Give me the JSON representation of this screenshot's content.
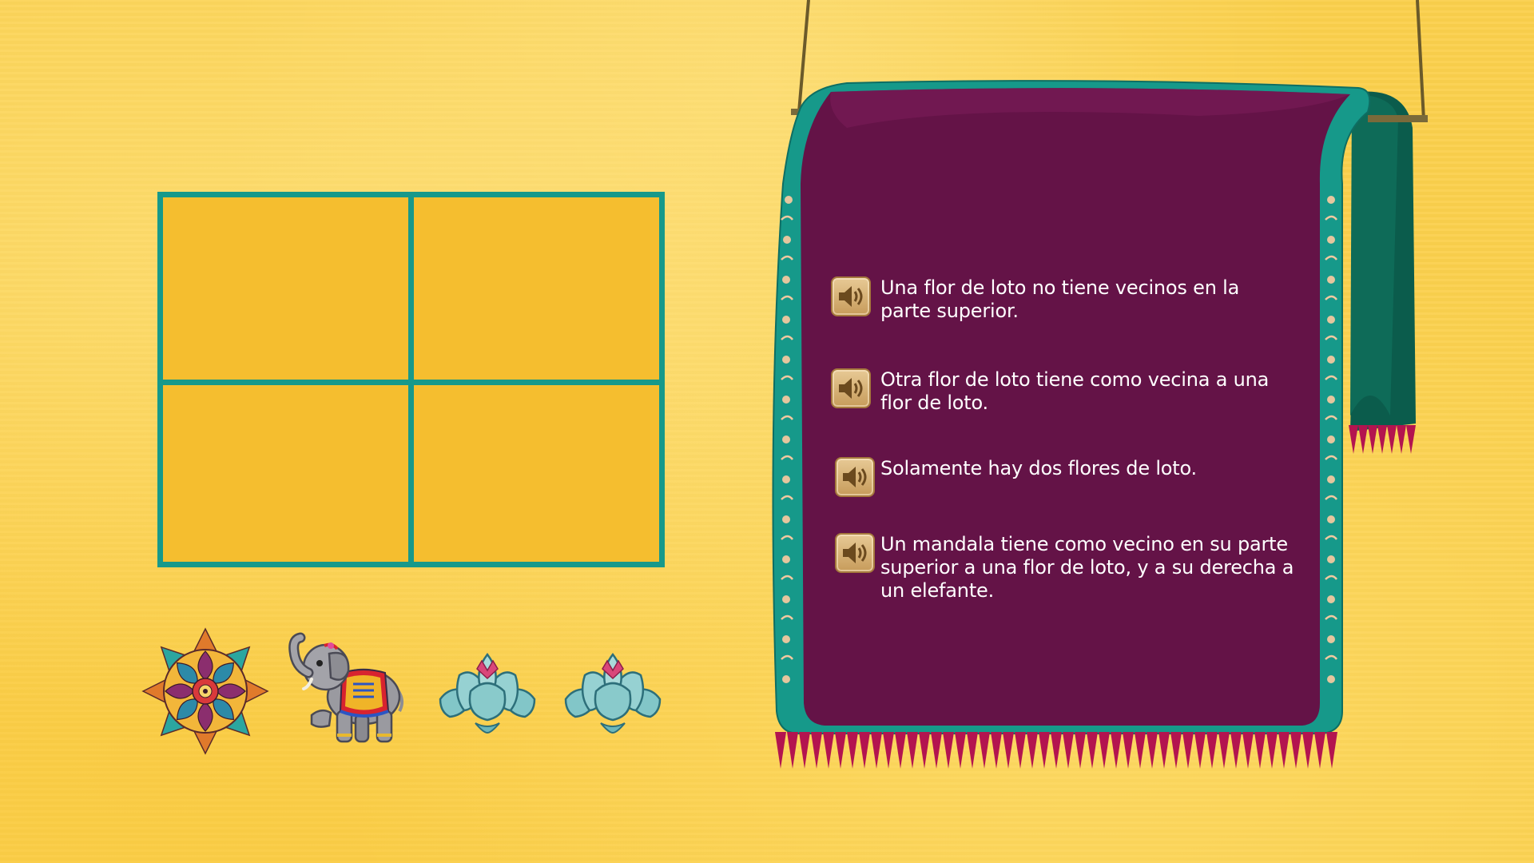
{
  "board": {
    "rows": 2,
    "cols": 2,
    "cells": [
      "",
      "",
      "",
      ""
    ]
  },
  "pieces": [
    {
      "name": "mandala",
      "icon": "mandala-icon"
    },
    {
      "name": "elephant",
      "icon": "elephant-icon"
    },
    {
      "name": "lotus",
      "icon": "lotus-flower-icon"
    },
    {
      "name": "lotus",
      "icon": "lotus-flower-icon"
    }
  ],
  "clues": [
    {
      "text": "Una flor de loto no tiene vecinos en la parte superior.",
      "icon": "speaker-icon"
    },
    {
      "text": "Otra flor de loto tiene como vecina a una flor de loto.",
      "icon": "speaker-icon"
    },
    {
      "text": "Solamente hay dos flores de loto.",
      "icon": "speaker-icon"
    },
    {
      "text": "Un mandala tiene como vecino en su parte superior a una flor de loto, y a su derecha a un elefante.",
      "icon": "speaker-icon"
    }
  ],
  "colors": {
    "background": "#fbd04c",
    "grid_line": "#17998a",
    "cell": "#f5be2f",
    "rug": "#641347",
    "rug_border": "#16998a",
    "rug_back": "#0b5c4c",
    "fringe": "#b3144f"
  }
}
